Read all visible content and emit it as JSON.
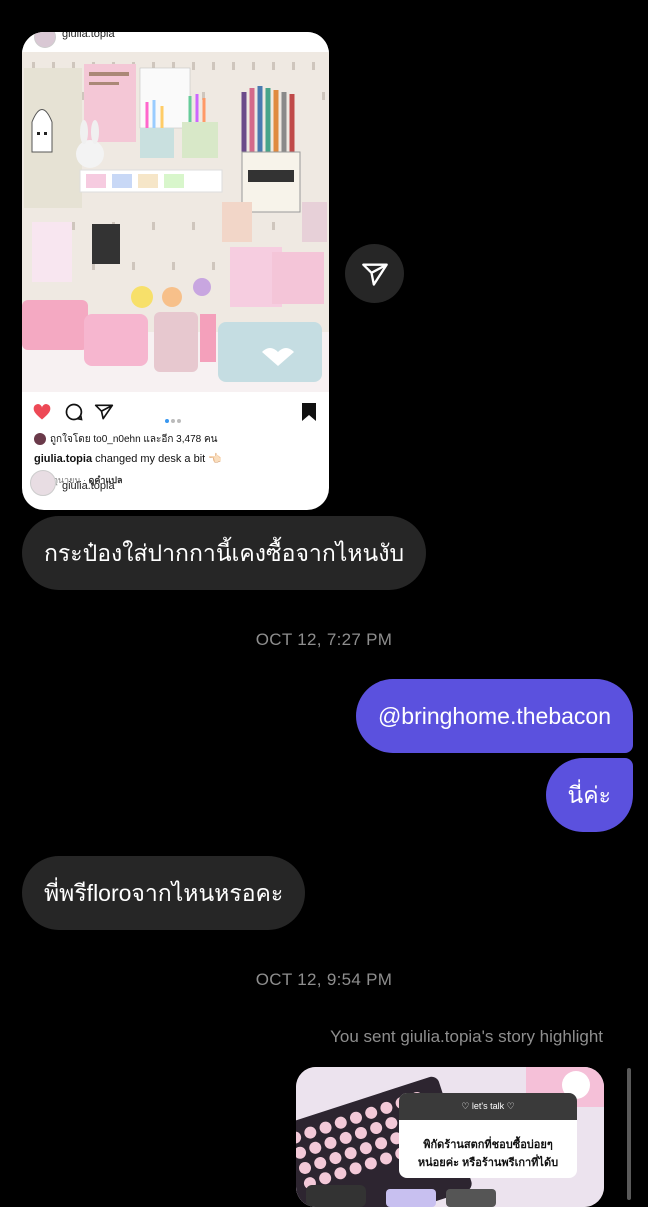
{
  "post": {
    "username": "giulia.topia",
    "liked_by": "ถูกใจโดย to0_n0ehn และอีก 3,478 คน",
    "caption_user": "giulia.topia",
    "caption_text": "changed my desk a bit",
    "date": "13 มิถุนายน",
    "translate": "ดูคำแปล",
    "footer_username": "giulia.topia"
  },
  "messages": [
    {
      "id": "m1",
      "direction": "incoming",
      "text": "กระป๋องใส่ปากกานี้เคงซื้อจากไหนงับ"
    },
    {
      "id": "m2",
      "direction": "outgoing",
      "text": "@bringhome.thebacon"
    },
    {
      "id": "m3",
      "direction": "outgoing",
      "text": "นี่ค่ะ"
    },
    {
      "id": "m4",
      "direction": "incoming",
      "text": "พี่พรีfloroจากไหนหรอคะ"
    }
  ],
  "timestamps": {
    "t1": "OCT 12, 7:27 PM",
    "t2": "OCT 12, 9:54 PM"
  },
  "story_note": "You sent giulia.topia's story highlight",
  "story": {
    "sticker_header": "♡ let's talk ♡",
    "line1": "พิกัดร้านสตกที่ชอบซื้อบ่อยๆ",
    "line2": "หน่อยค่ะ หรือร้านพรีเกาที่ได้บ"
  },
  "colors": {
    "outgoing_bubble": "#5b51de",
    "incoming_bubble": "#262626",
    "background": "#000000",
    "like": "#ed4956"
  },
  "icons": [
    "heart-icon",
    "comment-icon",
    "share-icon",
    "bookmark-icon",
    "send-arrow-icon"
  ]
}
